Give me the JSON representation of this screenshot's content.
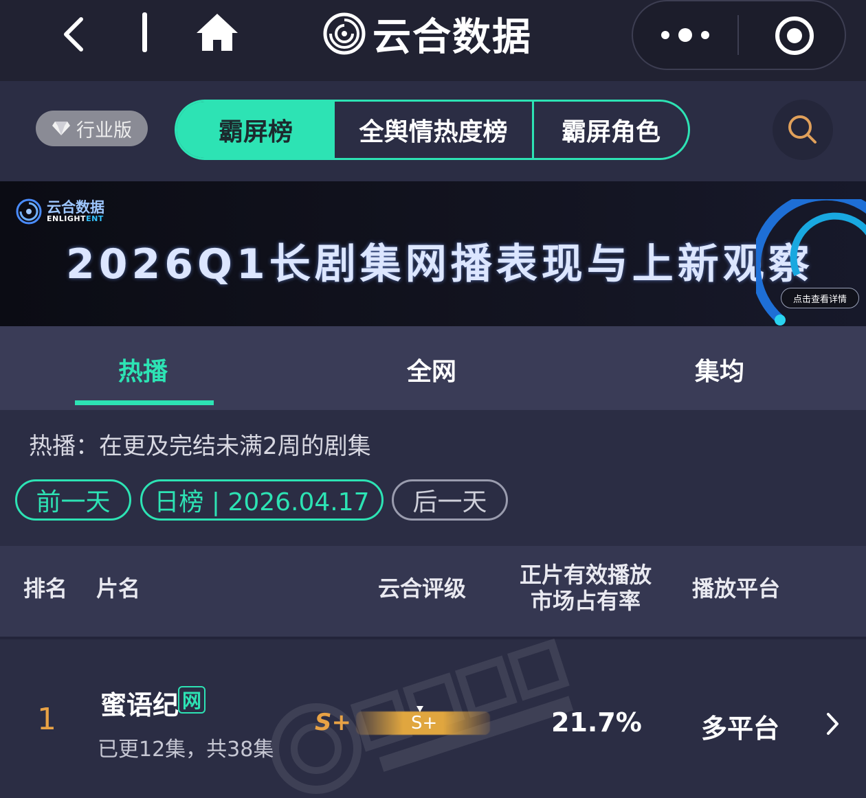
{
  "topbar": {
    "app_name": "云合数据",
    "back_icon": "chevron-left-icon",
    "home_icon": "home-icon",
    "menu_icon": "more-dots-icon",
    "close_icon": "target-icon"
  },
  "header": {
    "industry_label": "行业版",
    "tabs": [
      {
        "label": "霸屏榜",
        "active": true
      },
      {
        "label": "全舆情热度榜",
        "active": false
      },
      {
        "label": "霸屏角色",
        "active": false
      }
    ],
    "search_icon": "search-icon"
  },
  "banner": {
    "logo_cn": "云合数据",
    "logo_en_1": "ENLIGHT",
    "logo_en_2": "ENT",
    "title": "2026Q1长剧集网播表现与上新观察",
    "cta": "点击查看详情"
  },
  "subtabs": [
    {
      "label": "热播",
      "active": true
    },
    {
      "label": "全网",
      "active": false
    },
    {
      "label": "集均",
      "active": false
    }
  ],
  "description": "热播：在更及完结未满2周的剧集",
  "date_nav": {
    "prev": "前一天",
    "current": "日榜 | 2026.04.17",
    "next": "后一天"
  },
  "table": {
    "headers": {
      "rank": "排名",
      "title": "片名",
      "grade": "云合评级",
      "share_line1": "正片有效播放",
      "share_line2": "市场占有率",
      "platform": "播放平台"
    },
    "rows": [
      {
        "rank": "1",
        "title": "蜜语纪",
        "badge": "网",
        "episodes": "已更12集，共38集",
        "grade": "S+",
        "grade_bar_label": "S+",
        "share": "21.7%",
        "platform": "多平台"
      }
    ]
  },
  "colors": {
    "accent": "#2de3b4",
    "rank": "#e8a245",
    "background": "#2b2d44",
    "topbar": "#212232"
  }
}
